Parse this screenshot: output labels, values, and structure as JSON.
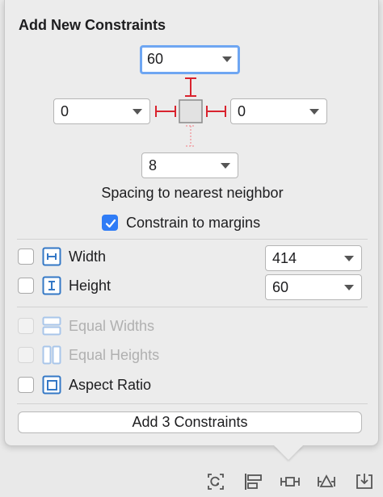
{
  "title": "Add New Constraints",
  "constraints": {
    "top": "60",
    "left": "0",
    "right": "0",
    "bottom": "8"
  },
  "spacing_caption": "Spacing to nearest neighbor",
  "constrain_to_margins": {
    "label": "Constrain to margins",
    "checked": true
  },
  "size_rows": [
    {
      "label": "Width",
      "value": "414",
      "checked": false,
      "icon": "width-icon"
    },
    {
      "label": "Height",
      "value": "60",
      "checked": false,
      "icon": "height-icon"
    }
  ],
  "equal_rows": [
    {
      "label": "Equal Widths",
      "enabled": false,
      "icon": "equal-widths-icon"
    },
    {
      "label": "Equal Heights",
      "enabled": false,
      "icon": "equal-heights-icon"
    },
    {
      "label": "Aspect Ratio",
      "enabled": true,
      "icon": "aspect-ratio-icon"
    }
  ],
  "add_button_label": "Add 3 Constraints",
  "toolbar_icons": [
    "update-frames-icon",
    "align-icon",
    "add-constraints-icon",
    "resolve-issues-icon",
    "embed-in-icon"
  ],
  "colors": {
    "accent": "#2f7cf6",
    "focus_ring": "#6ea6f2",
    "constraint_active": "#d9232e",
    "constraint_inactive": "#f0a0a5",
    "icon_blue": "#3478c6"
  }
}
